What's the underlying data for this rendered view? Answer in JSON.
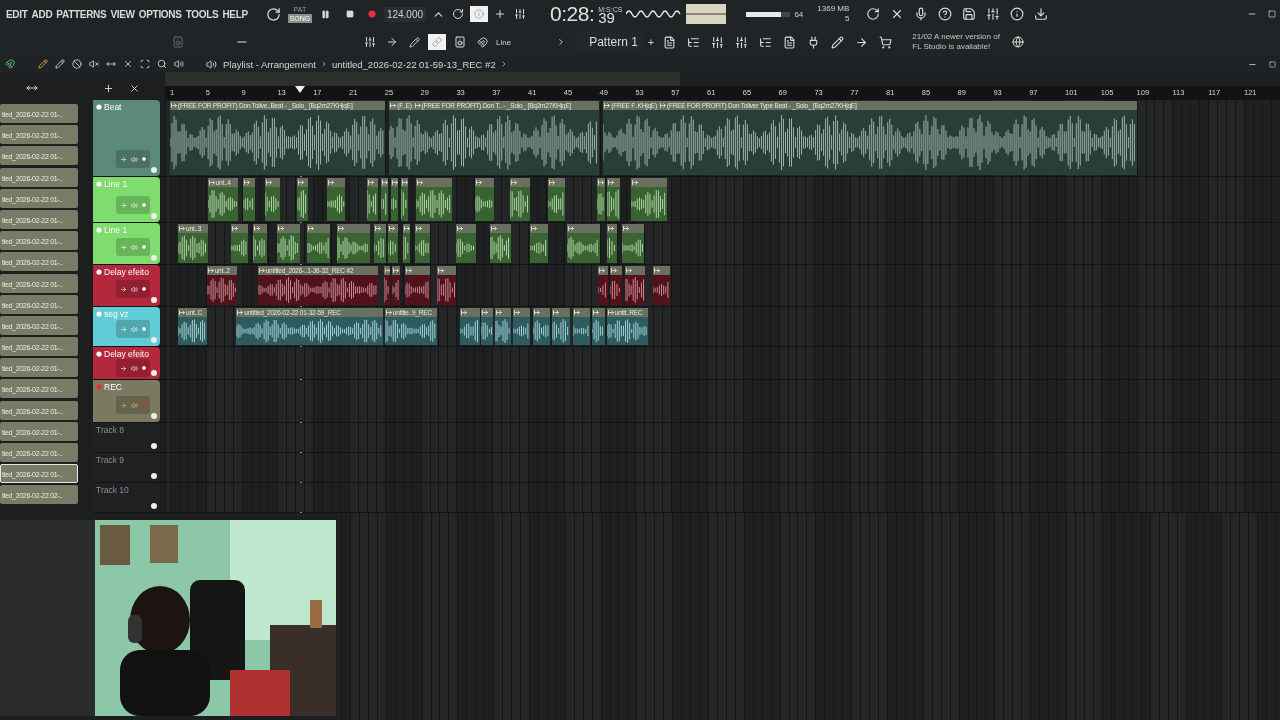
{
  "menu": [
    "EDIT",
    "ADD",
    "PATTERNS",
    "VIEW",
    "OPTIONS",
    "TOOLS",
    "HELP"
  ],
  "transport": {
    "modes": [
      {
        "label": "PAT",
        "selected": false
      },
      {
        "label": "SONG",
        "selected": true
      }
    ],
    "record_armed": true,
    "tempo": "124.000",
    "time_main": "0:28:",
    "time_cs": "39",
    "time_unit": "M:S:CS",
    "cpu": "64",
    "cpu_meter": {
      "level": 0.78
    },
    "memory": "1369 MB",
    "polyphony": "5"
  },
  "pattern": {
    "snap": "Line",
    "name": "Pattern 1",
    "add": "+"
  },
  "news": {
    "date": "21/02",
    "text": "A newer version of FL Studio is available!"
  },
  "playlist": {
    "title": "Playlist - Arrangement",
    "song": "untitled_2026-02-22 01-59-13_REC #2",
    "ruler": [
      "1",
      "5",
      "9",
      "13",
      "17",
      "21",
      "25",
      "29",
      "33",
      "37",
      "41",
      "45",
      "49",
      "53",
      "57",
      "61",
      "65",
      "69",
      "73",
      "77",
      "81",
      "85",
      "89",
      "93",
      "97",
      "101",
      "105",
      "109",
      "113",
      "117",
      "121"
    ]
  },
  "browser": [
    {
      "label": "tled_2026-02-22 01-..",
      "selected": false
    },
    {
      "label": "tled_2026-02-22 01-..",
      "selected": false
    },
    {
      "label": "tled_2026-02-22 01-..",
      "selected": false
    },
    {
      "label": "tled_2026-02-22 01-..",
      "selected": false
    },
    {
      "label": "tled_2026-02-22 01-..",
      "selected": false
    },
    {
      "label": "tled_2026-02-22 01-..",
      "selected": false
    },
    {
      "label": "tled_2026-02-22 01-..",
      "selected": false
    },
    {
      "label": "tled_2026-02-22 01-..",
      "selected": false
    },
    {
      "label": "tled_2026-02-22 01-..",
      "selected": false
    },
    {
      "label": "tled_2026-02-22 01-..",
      "selected": false
    },
    {
      "label": "tled_2026-02-22 01-..",
      "selected": false
    },
    {
      "label": "tled_2026-02-22 01-..",
      "selected": false
    },
    {
      "label": "tled_2026-02-22 01-..",
      "selected": false
    },
    {
      "label": "tled_2026-02-22 01-..",
      "selected": false
    },
    {
      "label": "tled_2026-02-22 01-..",
      "selected": false
    },
    {
      "label": "tled_2026-02-22 01-..",
      "selected": false
    },
    {
      "label": "tled_2026-02-22 01-..",
      "selected": false
    },
    {
      "label": "tled_2026-02-22 01-..",
      "selected": true
    },
    {
      "label": "tled_2026-02-22 02-..",
      "selected": false
    }
  ],
  "tracks": [
    {
      "name": "Beat",
      "kind": "audio",
      "color": "#5b8a78",
      "armed": false,
      "clips": [
        {
          "kind": "audio",
          "labels": [
            "(FREE FOR PROFIT) Don Tolive..Beat - _Solo_ [Bq2m27KHjqE]"
          ]
        },
        {
          "kind": "audio",
          "labels": [
            "(F..E)",
            "(FREE FOR PROFIT) Don T.. - _Solo_ [Bq2m27KHjqE]"
          ]
        },
        {
          "kind": "audio",
          "labels": [
            "(FREE F..KHjqE)",
            "(FREE FOR PROFIT) Don Toliver Type Beat - _Solo_ [Bq2m27KHjqE]"
          ]
        }
      ]
    },
    {
      "name": "Line 1",
      "kind": "audio",
      "color": "#7fdc6e",
      "armed": false,
      "clips": [
        {
          "kind": "audio",
          "labels": [
            "unt..4"
          ]
        },
        {
          "kind": "audio"
        },
        {
          "kind": "audio"
        },
        {
          "kind": "audio"
        },
        {
          "kind": "audio"
        },
        {
          "kind": "audio"
        },
        {
          "kind": "audio"
        },
        {
          "kind": "audio"
        },
        {
          "kind": "audio"
        },
        {
          "kind": "audio"
        },
        {
          "kind": "audio"
        },
        {
          "kind": "audio"
        },
        {
          "kind": "audio"
        },
        {
          "kind": "audio"
        },
        {
          "kind": "audio"
        },
        {
          "kind": "audio"
        }
      ]
    },
    {
      "name": "Line 1",
      "kind": "audio",
      "color": "#7fdc6e",
      "armed": false,
      "clips": [
        {
          "kind": "audio",
          "labels": [
            "unt..3"
          ]
        },
        {
          "kind": "audio"
        },
        {
          "kind": "audio"
        },
        {
          "kind": "audio"
        },
        {
          "kind": "audio"
        },
        {
          "kind": "audio"
        },
        {
          "kind": "audio"
        },
        {
          "kind": "audio"
        },
        {
          "kind": "audio"
        },
        {
          "kind": "audio"
        },
        {
          "kind": "audio"
        },
        {
          "kind": "audio"
        },
        {
          "kind": "audio"
        },
        {
          "kind": "audio"
        },
        {
          "kind": "audio"
        },
        {
          "kind": "audio"
        }
      ]
    },
    {
      "name": "Delay efeito",
      "kind": "audio",
      "color": "#b3283c",
      "armed": false,
      "clips": [
        {
          "kind": "audio",
          "labels": [
            "unt..2"
          ]
        },
        {
          "kind": "audio",
          "labels": [
            "untitled_2026-..1-36-32_REC #2"
          ]
        },
        {
          "kind": "audio"
        },
        {
          "kind": "audio"
        },
        {
          "kind": "audio"
        },
        {
          "kind": "audio"
        },
        {
          "kind": "audio"
        },
        {
          "kind": "audio"
        },
        {
          "kind": "audio"
        },
        {
          "kind": "audio"
        }
      ]
    },
    {
      "name": "seg vz",
      "kind": "audio",
      "color": "#62ccd6",
      "armed": false,
      "clips": [
        {
          "kind": "audio",
          "labels": [
            "unt..C"
          ]
        },
        {
          "kind": "audio",
          "labels": [
            "untitled_2026-02-22 01-32-59_REC"
          ]
        },
        {
          "kind": "audio",
          "labels": [
            "untitle..9_REC"
          ]
        },
        {
          "kind": "audio"
        },
        {
          "kind": "audio"
        },
        {
          "kind": "audio"
        },
        {
          "kind": "audio"
        },
        {
          "kind": "audio"
        },
        {
          "kind": "audio"
        },
        {
          "kind": "audio"
        },
        {
          "kind": "audio"
        },
        {
          "kind": "audio",
          "labels": [
            "untit..REC"
          ]
        }
      ]
    },
    {
      "name": "Delay efeito",
      "kind": "audio",
      "color": "#b3283c",
      "armed": false
    },
    {
      "name": "REC",
      "kind": "audio",
      "color": "#7b7a60",
      "armed": true
    },
    {
      "name": "Track 8",
      "kind": "empty"
    },
    {
      "name": "Track 9",
      "kind": "empty"
    },
    {
      "name": "Track 10",
      "kind": "empty"
    }
  ]
}
